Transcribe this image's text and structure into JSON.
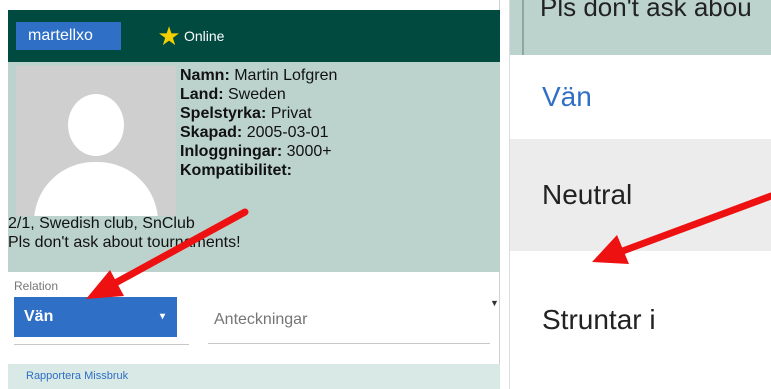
{
  "header": {
    "username": "martellxo",
    "status": "Online",
    "star_icon": "star-icon"
  },
  "profile": {
    "fields": [
      {
        "label": "Namn:",
        "value": " Martin Lofgren"
      },
      {
        "label": "Land:",
        "value": " Sweden"
      },
      {
        "label": "Spelstyrka:",
        "value": " Privat"
      },
      {
        "label": "Skapad:",
        "value": " 2005-03-01"
      },
      {
        "label": "Inloggningar:",
        "value": " 3000+"
      },
      {
        "label": "Kompatibilitet:",
        "value": ""
      }
    ],
    "bio_line1": "2/1, Swedish club, SnClub",
    "bio_line2": "Pls don't ask about tournaments!"
  },
  "relation": {
    "label": "Relation",
    "selected": "Vän"
  },
  "notes": {
    "placeholder": "Anteckningar"
  },
  "report": {
    "label": "Rapportera Missbruk"
  },
  "zoom": {
    "top_text": "Pls don't ask abou",
    "options": [
      "Vän",
      "Neutral",
      "Struntar i"
    ]
  },
  "colors": {
    "header_bg": "#004a40",
    "accent_blue": "#2f6fc5",
    "panel_bg": "#bcd3cd",
    "arrow_red": "#ee1111"
  }
}
